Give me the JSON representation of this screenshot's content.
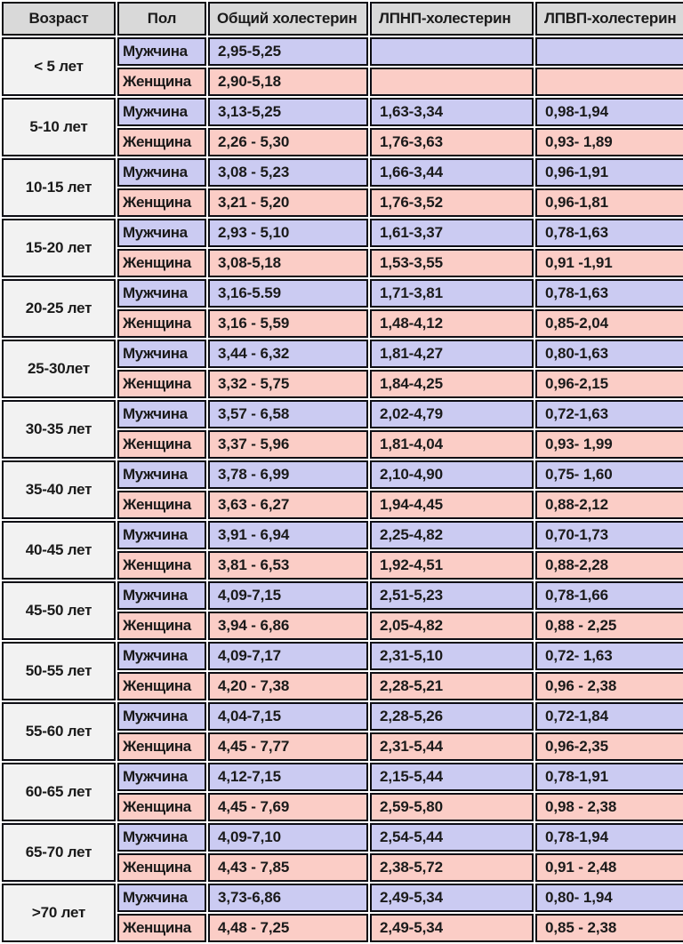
{
  "table": {
    "headers": [
      {
        "key": "age",
        "label": "Возраст"
      },
      {
        "key": "sex",
        "label": "Пол"
      },
      {
        "key": "total",
        "label": "Общий холестерин"
      },
      {
        "key": "ldl",
        "label": "ЛПНП-холестерин"
      },
      {
        "key": "hdl",
        "label": "ЛПВП-холестерин"
      }
    ],
    "colors": {
      "header_bg": "#d9d9d9",
      "age_bg": "#f2f2f2",
      "male_bg": "#cbcbf2",
      "female_bg": "#fbcdc6",
      "border": "#0d0d14",
      "text": "#1a1a1a"
    },
    "groups": [
      {
        "age": "< 5 лет",
        "rows": [
          {
            "sex": "Мужчина",
            "total": "2,95-5,25",
            "ldl": "",
            "hdl": ""
          },
          {
            "sex": "Женщина",
            "total": "2,90-5,18",
            "ldl": "",
            "hdl": ""
          }
        ]
      },
      {
        "age": "5-10 лет",
        "rows": [
          {
            "sex": "Мужчина",
            "total": "3,13-5,25",
            "ldl": "1,63-3,34",
            "hdl": "0,98-1,94"
          },
          {
            "sex": "Женщина",
            "total": "2,26 - 5,30",
            "ldl": "1,76-3,63",
            "hdl": "0,93- 1,89"
          }
        ]
      },
      {
        "age": "10-15 лет",
        "rows": [
          {
            "sex": "Мужчина",
            "total": "3,08 - 5,23",
            "ldl": "1,66-3,44",
            "hdl": "0,96-1,91"
          },
          {
            "sex": "Женщина",
            "total": "3,21 - 5,20",
            "ldl": "1,76-3,52",
            "hdl": "0,96-1,81"
          }
        ]
      },
      {
        "age": "15-20 лет",
        "rows": [
          {
            "sex": "Мужчина",
            "total": "2,93 - 5,10",
            "ldl": "1,61-3,37",
            "hdl": "0,78-1,63"
          },
          {
            "sex": "Женщина",
            "total": "3,08-5,18",
            "ldl": "1,53-3,55",
            "hdl": "0,91 -1,91"
          }
        ]
      },
      {
        "age": "20-25 лет",
        "rows": [
          {
            "sex": "Мужчина",
            "total": "3,16-5.59",
            "ldl": "1,71-3,81",
            "hdl": "0,78-1,63"
          },
          {
            "sex": "Женщина",
            "total": "3,16 - 5,59",
            "ldl": "1,48-4,12",
            "hdl": "0,85-2,04"
          }
        ]
      },
      {
        "age": "25-30лет",
        "rows": [
          {
            "sex": "Мужчина",
            "total": "3,44 - 6,32",
            "ldl": "1,81-4,27",
            "hdl": "0,80-1,63"
          },
          {
            "sex": "Женщина",
            "total": "3,32 - 5,75",
            "ldl": "1,84-4,25",
            "hdl": "0,96-2,15"
          }
        ]
      },
      {
        "age": "30-35 лет",
        "rows": [
          {
            "sex": "Мужчина",
            "total": "3,57 - 6,58",
            "ldl": "2,02-4,79",
            "hdl": "0,72-1,63"
          },
          {
            "sex": "Женщина",
            "total": "3,37 - 5,96",
            "ldl": "1,81-4,04",
            "hdl": "0,93- 1,99"
          }
        ]
      },
      {
        "age": "35-40 лет",
        "rows": [
          {
            "sex": "Мужчина",
            "total": "3,78 - 6,99",
            "ldl": "2,10-4,90",
            "hdl": "0,75- 1,60"
          },
          {
            "sex": "Женщина",
            "total": "3,63 - 6,27",
            "ldl": "1,94-4,45",
            "hdl": "0,88-2,12"
          }
        ]
      },
      {
        "age": "40-45 лет",
        "rows": [
          {
            "sex": "Мужчина",
            "total": "3,91 - 6,94",
            "ldl": "2,25-4,82",
            "hdl": "0,70-1,73"
          },
          {
            "sex": "Женщина",
            "total": "3,81 - 6,53",
            "ldl": "1,92-4,51",
            "hdl": "0,88-2,28"
          }
        ]
      },
      {
        "age": "45-50 лет",
        "rows": [
          {
            "sex": "Мужчина",
            "total": "4,09-7,15",
            "ldl": "2,51-5,23",
            "hdl": "0,78-1,66"
          },
          {
            "sex": "Женщина",
            "total": "3,94 - 6,86",
            "ldl": "2,05-4,82",
            "hdl": "0,88 - 2,25"
          }
        ]
      },
      {
        "age": "50-55 лет",
        "rows": [
          {
            "sex": "Мужчина",
            "total": "4,09-7,17",
            "ldl": "2,31-5,10",
            "hdl": "0,72- 1,63"
          },
          {
            "sex": "Женщина",
            "total": "4,20 - 7,38",
            "ldl": "2,28-5,21",
            "hdl": "0,96 - 2,38"
          }
        ]
      },
      {
        "age": "55-60 лет",
        "rows": [
          {
            "sex": "Мужчина",
            "total": "4,04-7,15",
            "ldl": "2,28-5,26",
            "hdl": "0,72-1,84"
          },
          {
            "sex": "Женщина",
            "total": "4,45 - 7,77",
            "ldl": "2,31-5,44",
            "hdl": "0,96-2,35"
          }
        ]
      },
      {
        "age": "60-65 лет",
        "rows": [
          {
            "sex": "Мужчина",
            "total": "4,12-7,15",
            "ldl": "2,15-5,44",
            "hdl": "0,78-1,91"
          },
          {
            "sex": "Женщина",
            "total": "4,45 - 7,69",
            "ldl": "2,59-5,80",
            "hdl": "0,98 - 2,38"
          }
        ]
      },
      {
        "age": "65-70 лет",
        "rows": [
          {
            "sex": "Мужчина",
            "total": "4,09-7,10",
            "ldl": "2,54-5,44",
            "hdl": "0,78-1,94"
          },
          {
            "sex": "Женщина",
            "total": "4,43 - 7,85",
            "ldl": "2,38-5,72",
            "hdl": "0,91 - 2,48"
          }
        ]
      },
      {
        "age": ">70 лет",
        "rows": [
          {
            "sex": "Мужчина",
            "total": "3,73-6,86",
            "ldl": "2,49-5,34",
            "hdl": "0,80- 1,94"
          },
          {
            "sex": "Женщина",
            "total": "4,48 - 7,25",
            "ldl": "2,49-5,34",
            "hdl": "0,85 - 2,38"
          }
        ]
      }
    ]
  }
}
